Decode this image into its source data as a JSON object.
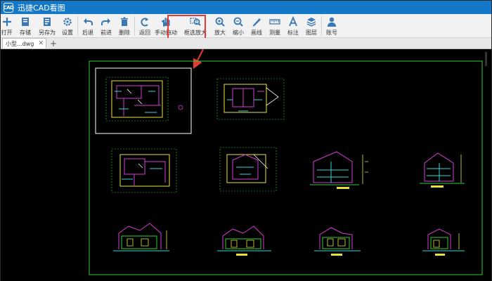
{
  "app": {
    "title": "迅捷CAD看图",
    "logo_text": "CAD"
  },
  "toolbar": {
    "items": [
      {
        "label": "打开",
        "icon": "plus-icon"
      },
      {
        "label": "存储",
        "icon": "save-icon"
      },
      {
        "label": "另存为",
        "icon": "save-as-icon"
      },
      {
        "label": "设置",
        "icon": "gear-icon"
      },
      {
        "label": "后退",
        "icon": "undo-icon"
      },
      {
        "label": "前进",
        "icon": "redo-icon"
      },
      {
        "label": "删除",
        "icon": "trash-icon"
      },
      {
        "label": "返回",
        "icon": "return-icon"
      },
      {
        "label": "手动拖动",
        "icon": "hand-icon"
      },
      {
        "label": "框选放大",
        "icon": "zoom-box-icon"
      },
      {
        "label": "放大",
        "icon": "zoom-in-icon"
      },
      {
        "label": "缩小",
        "icon": "zoom-out-icon"
      },
      {
        "label": "画线",
        "icon": "pen-icon"
      },
      {
        "label": "测量",
        "icon": "ruler-icon"
      },
      {
        "label": "标注",
        "icon": "text-a-icon"
      },
      {
        "label": "图层",
        "icon": "layers-icon"
      },
      {
        "label": "账号",
        "icon": "user-icon"
      }
    ]
  },
  "tabs": [
    {
      "label": "小型...dwg"
    }
  ],
  "colors": {
    "titlebar": "#1478c8",
    "toolbar_icon": "#3a78b5",
    "highlight": "#e53935",
    "drawing_frame": "#2bd13a",
    "selection_frame": "#ffffff",
    "cad_yellow": "#e8e33a",
    "cad_magenta": "#d63cd6",
    "cad_cyan": "#38d6d6",
    "cad_green": "#2bd13a"
  }
}
